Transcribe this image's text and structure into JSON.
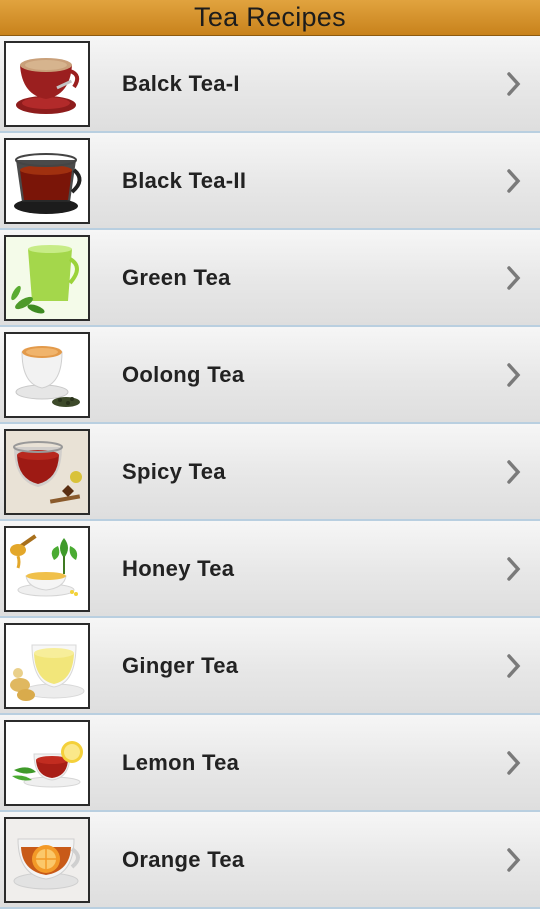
{
  "header": {
    "title": "Tea Recipes"
  },
  "recipes": [
    {
      "label": "Balck Tea-I",
      "thumbnail_icon": "black-tea-cup-saucer-icon"
    },
    {
      "label": "Black Tea-II",
      "thumbnail_icon": "black-tea-glass-cup-icon"
    },
    {
      "label": "Green Tea",
      "thumbnail_icon": "green-tea-cup-icon"
    },
    {
      "label": "Oolong Tea",
      "thumbnail_icon": "oolong-tea-cup-icon"
    },
    {
      "label": "Spicy Tea",
      "thumbnail_icon": "spicy-tea-cup-icon"
    },
    {
      "label": "Honey Tea",
      "thumbnail_icon": "honey-tea-cup-icon"
    },
    {
      "label": "Ginger Tea",
      "thumbnail_icon": "ginger-tea-cup-icon"
    },
    {
      "label": "Lemon Tea",
      "thumbnail_icon": "lemon-tea-cup-icon"
    },
    {
      "label": "Orange Tea",
      "thumbnail_icon": "orange-tea-cup-icon"
    }
  ],
  "colors": {
    "header_bar": "#d08f2a",
    "row_background": "#ececec",
    "row_divider": "#b9cfe0",
    "chevron": "#7a7a7a"
  }
}
